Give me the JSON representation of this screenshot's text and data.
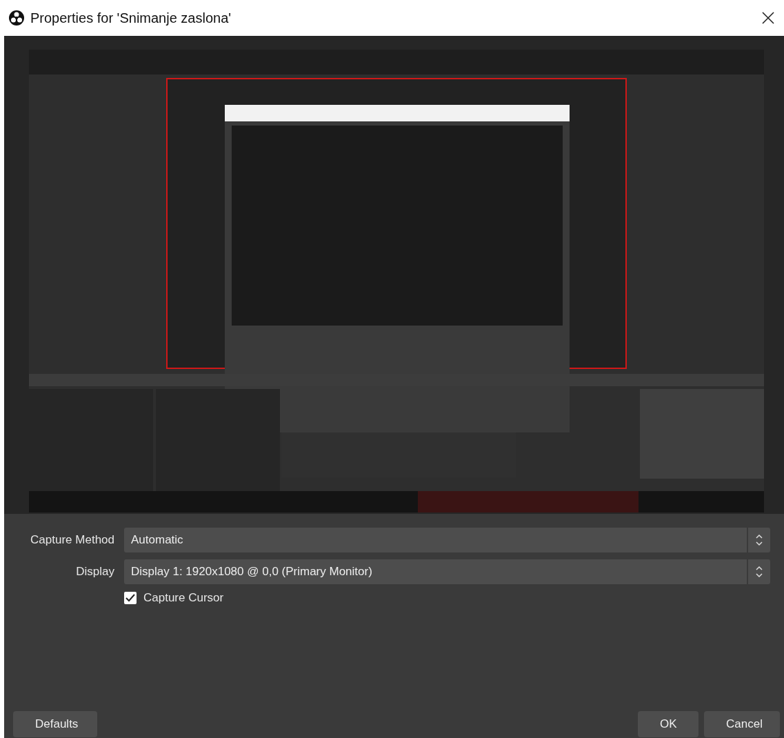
{
  "window": {
    "title": "Properties for 'Snimanje zaslona'"
  },
  "fields": [
    {
      "kind": "select",
      "label": "Capture Method",
      "value": "Automatic"
    },
    {
      "kind": "select",
      "label": "Display",
      "value": "Display 1: 1920x1080 @ 0,0 (Primary Monitor)"
    },
    {
      "kind": "checkbox",
      "label": "Capture Cursor",
      "checked": true
    }
  ],
  "buttons": {
    "defaults": "Defaults",
    "ok": "OK",
    "cancel": "Cancel"
  }
}
